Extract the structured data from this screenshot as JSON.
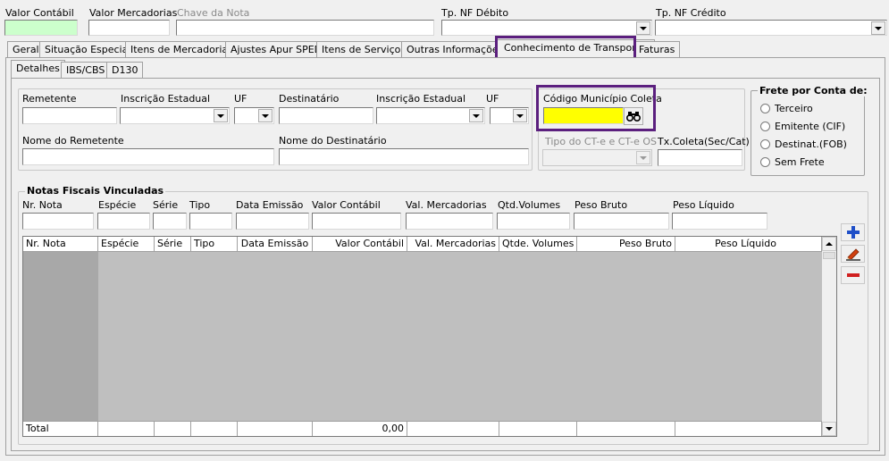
{
  "header": {
    "valor_contabil": "Valor Contábil",
    "valor_mercadorias": "Valor Mercadorias",
    "chave_nota": "Chave da Nota",
    "tp_nf_debito": "Tp. NF Débito",
    "tp_nf_credito": "Tp. NF Crédito"
  },
  "tabs": [
    "Geral",
    "Situação Especial",
    "Itens de Mercadorias",
    "Ajustes Apur SPED",
    "Itens de Serviços",
    "Outras Informações",
    "Conhecimento de Transporte",
    "Faturas"
  ],
  "subtabs": [
    "Detalhes",
    "IBS/CBS",
    "D130"
  ],
  "form": {
    "remetente": "Remetente",
    "insc_estadual_1": "Inscrição Estadual",
    "uf_1": "UF",
    "destinatario": "Destinatário",
    "insc_estadual_2": "Inscrição Estadual",
    "uf_2": "UF",
    "nome_remetente": "Nome do Remetente",
    "nome_destinatario": "Nome do Destinatário",
    "codigo_municipio_coleta": "Código Município Coleta",
    "tipo_cte": "Tipo do CT-e e CT-e OS",
    "tx_coleta": "Tx.Coleta(Sec/Cat)"
  },
  "frete": {
    "title": "Frete por Conta de:",
    "options": [
      "Terceiro",
      "Emitente (CIF)",
      "Destinat.(FOB)",
      "Sem Frete"
    ]
  },
  "notas": {
    "title": "Notas Fiscais Vinculadas",
    "fields": [
      "Nr. Nota",
      "Espécie",
      "Série",
      "Tipo",
      "Data Emissão",
      "Valor Contábil",
      "Val. Mercadorias",
      "Qtd.Volumes",
      "Peso Bruto",
      "Peso Líquido"
    ],
    "columns": [
      "Nr. Nota",
      "Espécie",
      "Série",
      "Tipo",
      "Data Emissão",
      "Valor Contábil",
      "Val. Mercadorias",
      "Qtde. Volumes",
      "Peso Bruto",
      "Peso Líquido"
    ],
    "total_label": "Total",
    "total_valor_contabil": "0,00"
  },
  "colors": {
    "highlight": "#5b1f7e",
    "accent_yellow": "#ffff00",
    "total_bg": "#ccffcc"
  },
  "icons": {
    "search": "binoculars-icon",
    "add": "plus-icon",
    "edit": "pencil-icon",
    "remove": "minus-icon"
  }
}
